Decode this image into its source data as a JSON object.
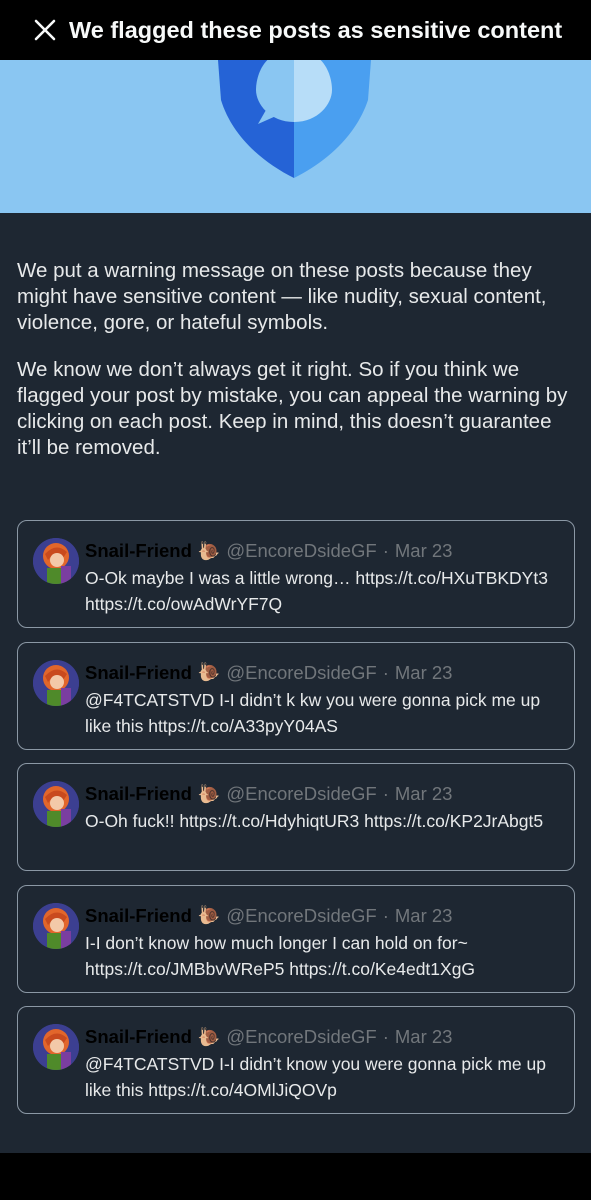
{
  "header": {
    "title": "We flagged these posts as sensitive content",
    "close_icon": "close-icon"
  },
  "colors": {
    "topbar": "#000000",
    "hero": "#8ac6f2",
    "background": "#1e2732",
    "shield_dark": "#2563d6",
    "shield_light": "#4a9ff0"
  },
  "intro": {
    "paragraph1": "We put a warning message on these posts because they might have sensitive content — like nudity, sexual content, violence, gore, or hateful symbols.",
    "paragraph2": "We know we don’t always get it right. So if you think we flagged your post by mistake, you can appeal the warning by clicking on each post. Keep in mind, this doesn’t guarantee it’ll be removed."
  },
  "posts": [
    {
      "name": "Snail-Friend",
      "badge": "🐌",
      "handle": "@EncoreDsideGF",
      "separator": "·",
      "date": "Mar 23",
      "text": "O-Ok maybe I was a little wrong… https://t.co/HXuTBKDYt3 https://t.co/owAdWrYF7Q"
    },
    {
      "name": "Snail-Friend",
      "badge": "🐌",
      "handle": "@EncoreDsideGF",
      "separator": "·",
      "date": "Mar 23",
      "text": "@F4TCATSTVD I-I didn’t k kw you were gonna pick me up like this https://t.co/A33pyY04AS"
    },
    {
      "name": "Snail-Friend",
      "badge": "🐌",
      "handle": "@EncoreDsideGF",
      "separator": "·",
      "date": "Mar 23",
      "text": "O-Oh fuck!! https://t.co/HdyhiqtUR3 https://t.co/KP2JrAbgt5"
    },
    {
      "name": "Snail-Friend",
      "badge": "🐌",
      "handle": "@EncoreDsideGF",
      "separator": "·",
      "date": "Mar 23",
      "text": "I-I don’t know how much longer I can hold on for~ https://t.co/JMBbvWReP5 https://t.co/Ke4edt1XgG"
    },
    {
      "name": "Snail-Friend",
      "badge": "🐌",
      "handle": "@EncoreDsideGF",
      "separator": "·",
      "date": "Mar 23",
      "text": "@F4TCATSTVD I-I didn’t know you were gonna pick me up like this https://t.co/4OMlJiQOVp"
    }
  ]
}
